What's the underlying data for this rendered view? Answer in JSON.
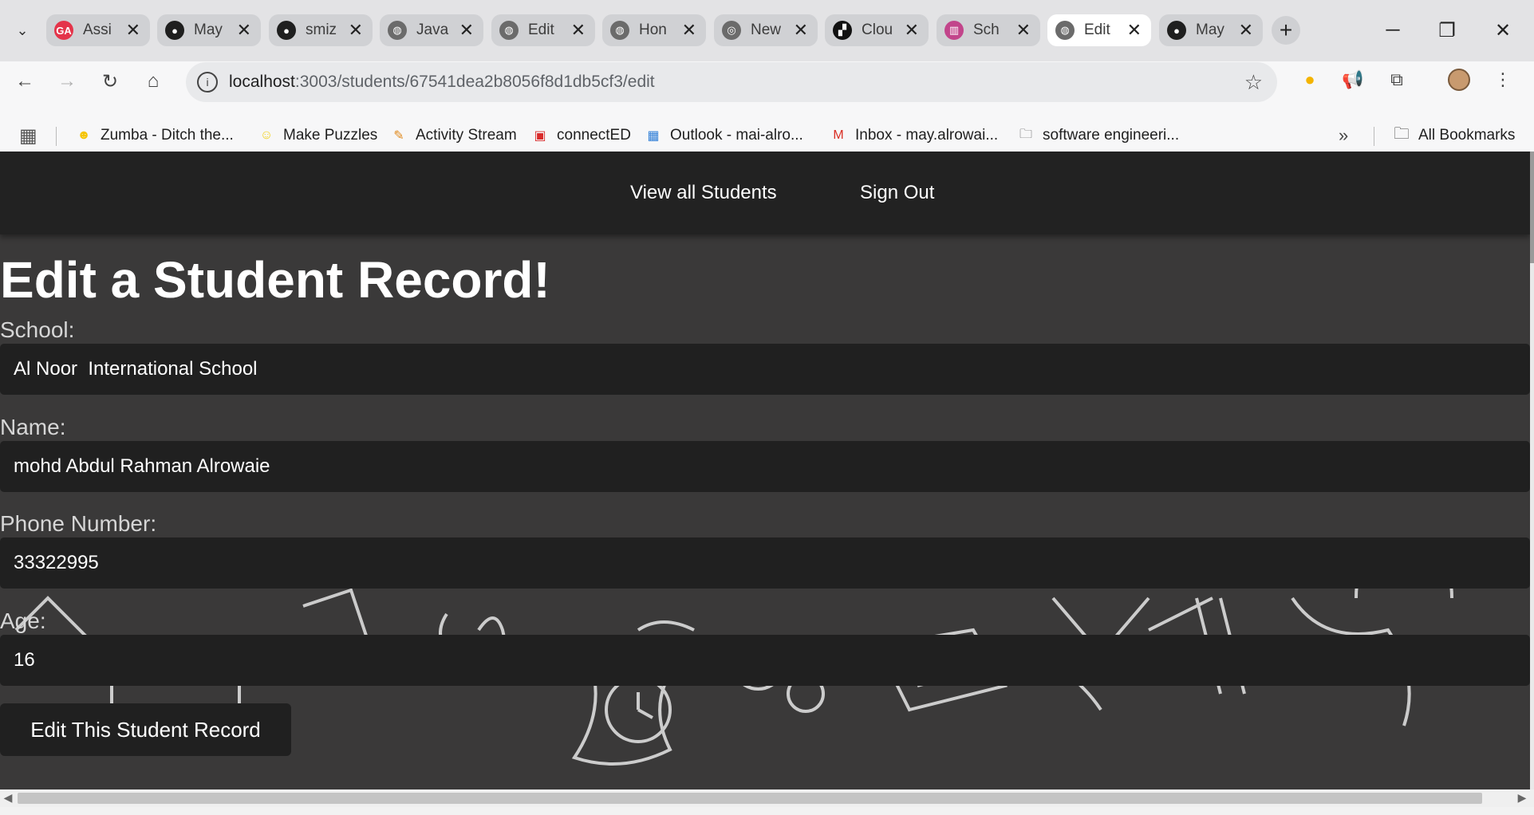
{
  "browser": {
    "tabs": [
      {
        "label": "Assi",
        "favicon": "ga-icon",
        "favicon_color": "#e4344a",
        "favicon_glyph": "GA",
        "active": false
      },
      {
        "label": "May",
        "favicon": "github-icon",
        "favicon_color": "#1f1f1f",
        "favicon_glyph": "●",
        "active": false
      },
      {
        "label": "smiz",
        "favicon": "github-icon",
        "favicon_color": "#1f1f1f",
        "favicon_glyph": "●",
        "active": false
      },
      {
        "label": "Java",
        "favicon": "globe-icon",
        "favicon_color": "#6b6b6b",
        "favicon_glyph": "◍",
        "active": false
      },
      {
        "label": "Edit",
        "favicon": "globe-icon",
        "favicon_color": "#6b6b6b",
        "favicon_glyph": "◍",
        "active": false
      },
      {
        "label": "Hon",
        "favicon": "globe-icon",
        "favicon_color": "#6b6b6b",
        "favicon_glyph": "◍",
        "active": false
      },
      {
        "label": "New",
        "favicon": "chrome-icon",
        "favicon_color": "#6b6b6b",
        "favicon_glyph": "◎",
        "active": false
      },
      {
        "label": "Clou",
        "favicon": "cloud-icon",
        "favicon_color": "#111111",
        "favicon_glyph": "▞",
        "active": false
      },
      {
        "label": "Sch",
        "favicon": "trello-icon",
        "favicon_color": "#c2458b",
        "favicon_glyph": "▥",
        "active": false
      },
      {
        "label": "Edit",
        "favicon": "globe-icon",
        "favicon_color": "#6b6b6b",
        "favicon_glyph": "◍",
        "active": true
      },
      {
        "label": "May",
        "favicon": "github-icon",
        "favicon_color": "#1f1f1f",
        "favicon_glyph": "●",
        "active": false
      }
    ],
    "url_host": "localhost",
    "url_path": ":3003/students/67541dea2b8056f8d1db5cf3/edit",
    "bookmarks": [
      {
        "label": "Zumba - Ditch the...",
        "icon": "zumba-icon",
        "color": "#f5c400"
      },
      {
        "label": "Make Puzzles",
        "icon": "smiley-icon",
        "color": "#f3d21c"
      },
      {
        "label": "Activity Stream",
        "icon": "pencil-icon",
        "color": "#e08a1e"
      },
      {
        "label": "connectED",
        "icon": "mcgraw-hill-icon",
        "color": "#d92b2b"
      },
      {
        "label": "Outlook - mai-alro...",
        "icon": "microsoft-icon",
        "color": "#2e7dd7"
      },
      {
        "label": "Inbox - may.alrowai...",
        "icon": "gmail-icon",
        "color": "#d93025"
      },
      {
        "label": "software engineeri...",
        "icon": "folder-icon",
        "color": "#444444"
      }
    ],
    "all_bookmarks_label": "All Bookmarks"
  },
  "navbar": {
    "view_all_label": "View all Students",
    "sign_out_label": "Sign Out"
  },
  "form": {
    "title": "Edit a Student Record!",
    "school_label": "School:",
    "school_value": "Al Noor  International School",
    "name_label": "Name:",
    "name_value": "mohd Abdul Rahman Alrowaie",
    "phone_label": "Phone Number:",
    "phone_value": "33322995",
    "age_label": "Age:",
    "age_value": "16",
    "submit_label": "Edit This Student Record"
  },
  "colors": {
    "navbar_bg": "#222222",
    "page_bg": "#3a3939",
    "input_bg": "#202020",
    "text": "#ffffff"
  }
}
